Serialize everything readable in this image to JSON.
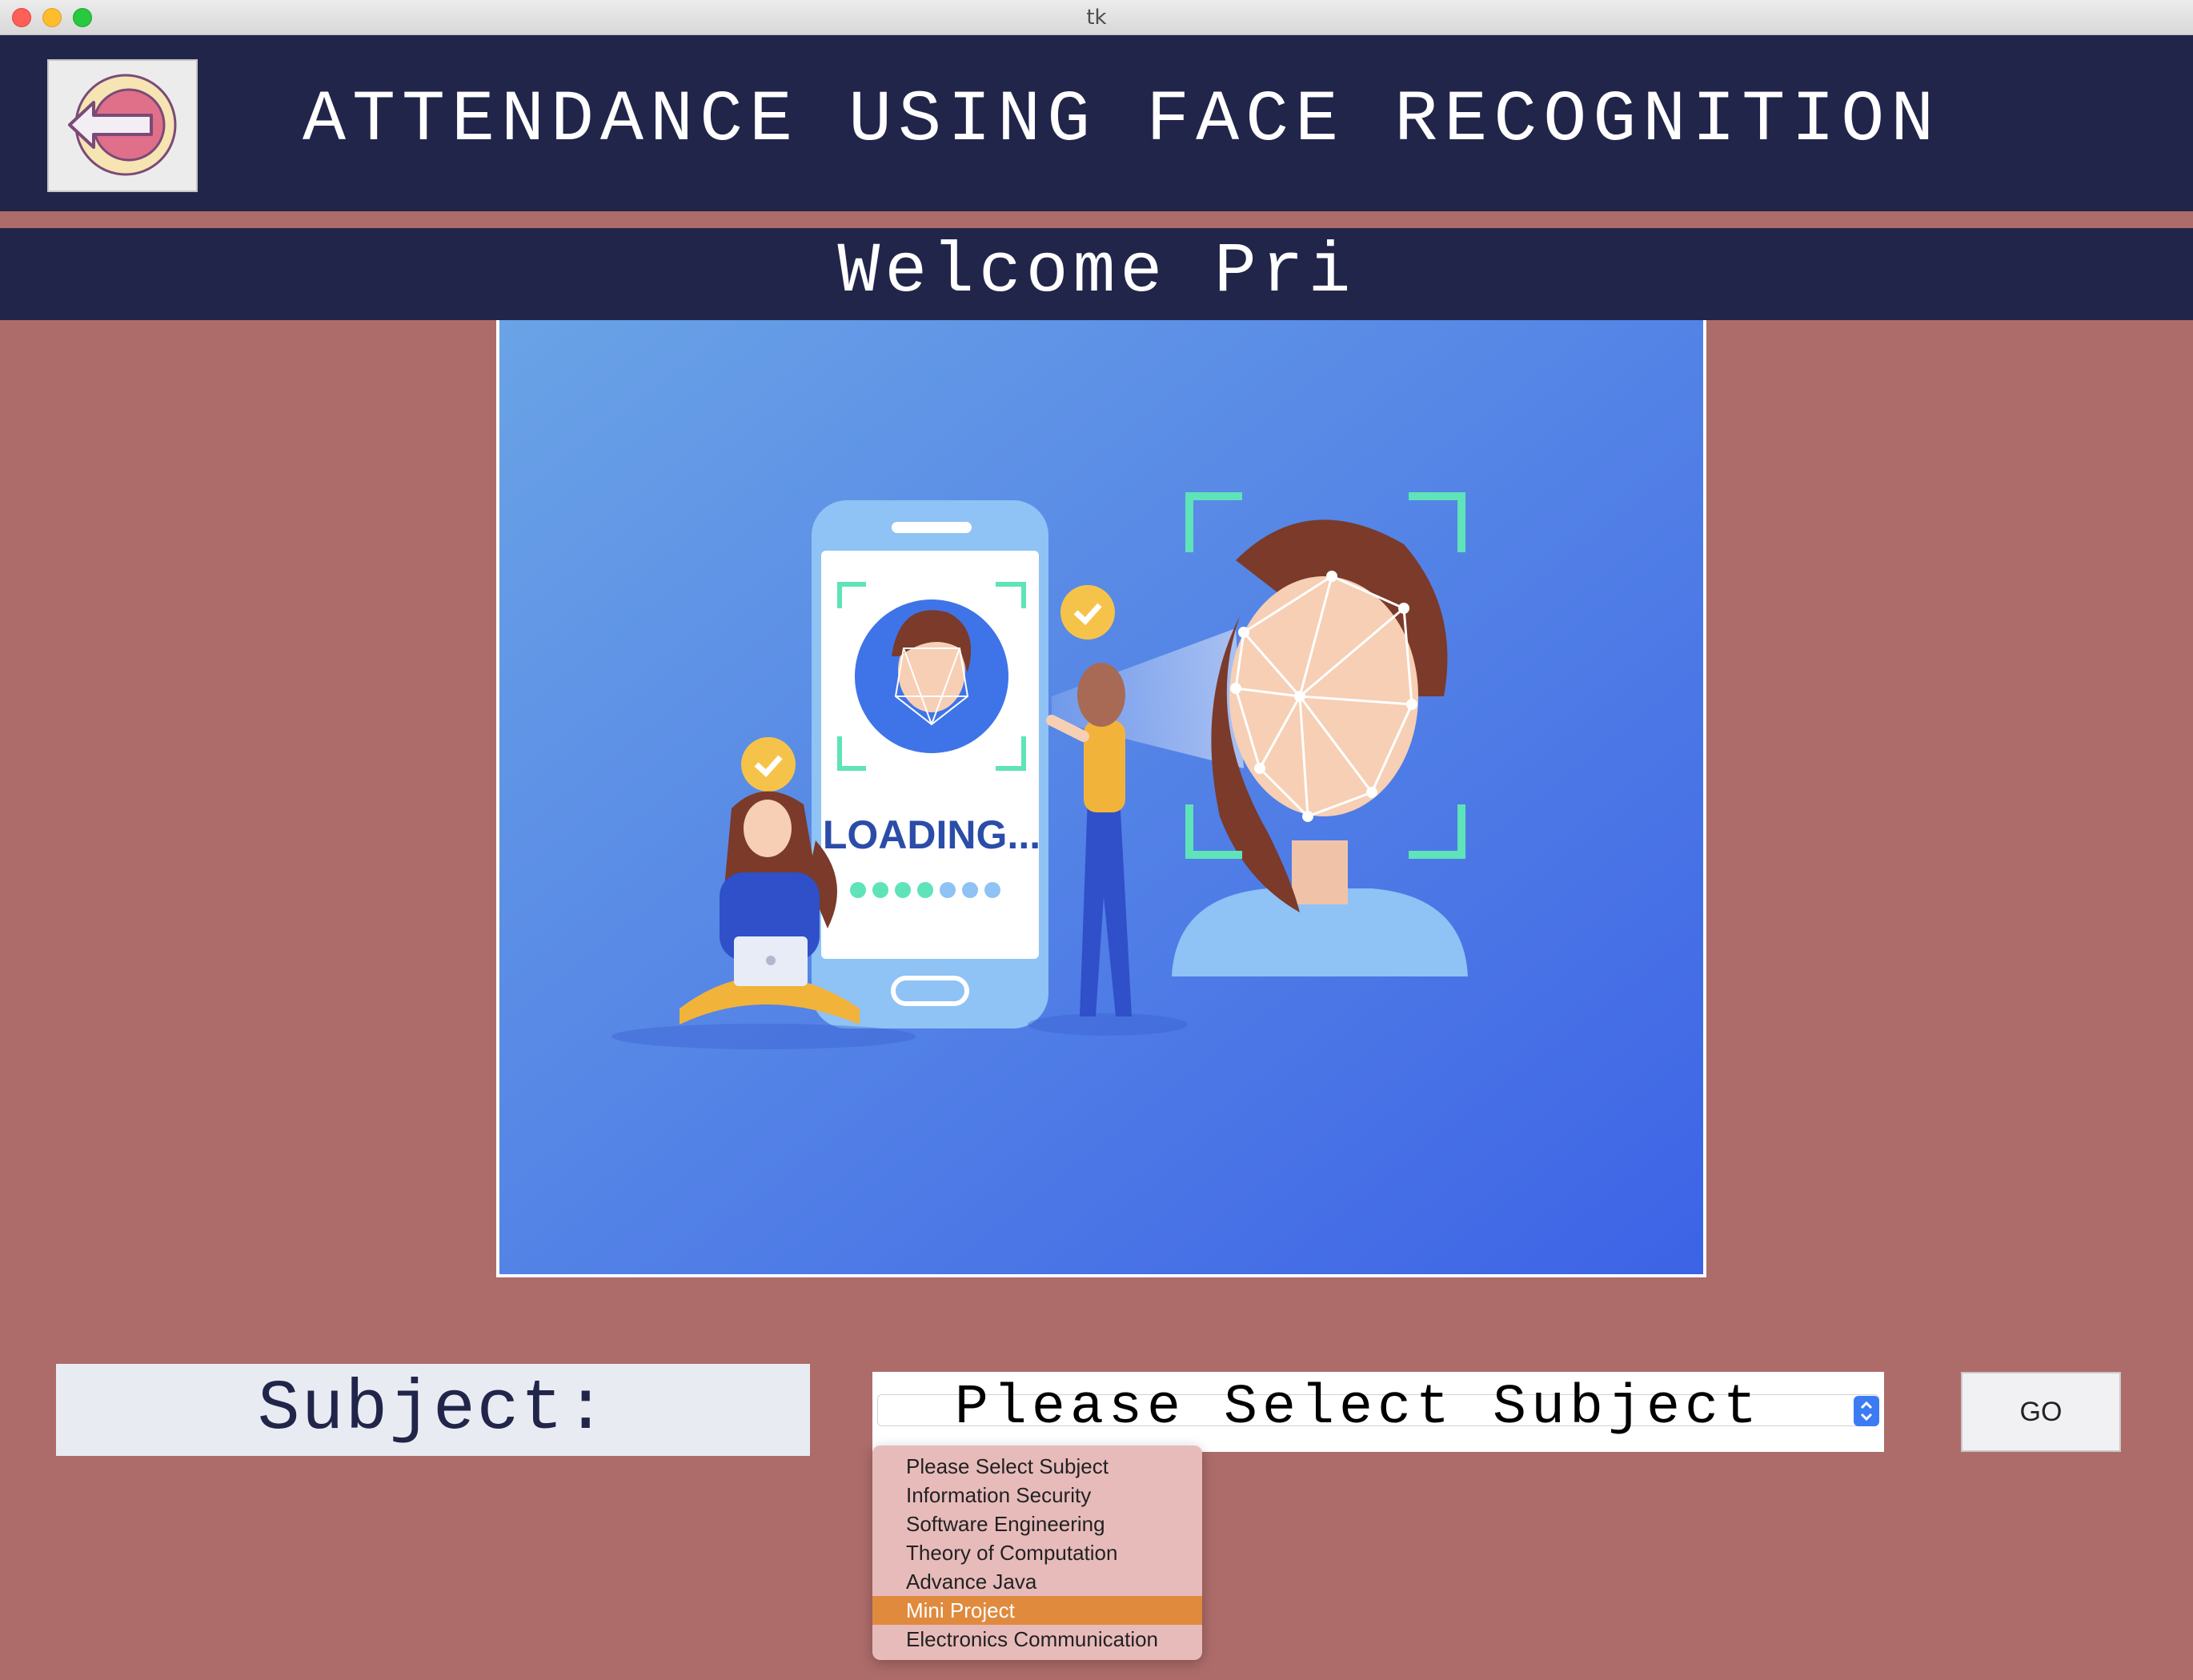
{
  "window": {
    "title": "tk"
  },
  "header": {
    "title": "ATTENDANCE USING FACE RECOGNITION",
    "back_icon": "logout-arrow-icon"
  },
  "welcome": {
    "text": "Welcome Pri"
  },
  "illustration": {
    "phone_text": "LOADING..."
  },
  "form": {
    "subject_label": "Subject:",
    "selected_value": "Please Select Subject",
    "go_label": "GO",
    "options": [
      "Please Select Subject",
      "Information Security",
      "Software Engineering",
      "Theory of Computation",
      "Advance Java",
      "Mini Project",
      "Electronics Communication"
    ],
    "highlighted_option": "Mini Project"
  },
  "colors": {
    "background": "#ad6c6a",
    "header": "#22254a",
    "illustration_blue": "#4a86e6",
    "highlight": "#e08a3e",
    "dropdown_bg": "#e8bbbb"
  }
}
